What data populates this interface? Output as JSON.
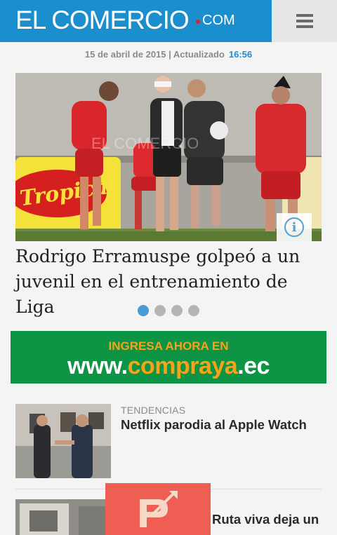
{
  "header": {
    "logo_main": "EL COMERCIO",
    "logo_suffix": "COM",
    "menu_icon": "hamburger-menu-icon"
  },
  "dateline": {
    "date": "15 de abril de 2015 | Actualizado",
    "time": "16:56"
  },
  "hero": {
    "image_icon": "info-icon",
    "info_glyph": "i",
    "headline": "Rodrigo Erramuspe golpeó a un juvenil en el entrenamiento de Liga",
    "slide_count": 4,
    "active_slide": 1
  },
  "ad": {
    "tagline": "INGRESA AHORA EN",
    "url_prefix": "www.",
    "url_brand": "compraya",
    "url_suffix": ".ec"
  },
  "news": [
    {
      "category": "TENDENCIAS",
      "title": "Netflix parodia al Apple Watch"
    },
    {
      "category": "",
      "title": "Ruta viva deja un"
    }
  ],
  "overlay": {
    "icon": "app-logo-icon"
  },
  "colors": {
    "brand_blue": "#1b8fce",
    "ad_green": "#0d9444",
    "ad_orange": "#f6a319",
    "overlay_red": "#ee5e52"
  }
}
